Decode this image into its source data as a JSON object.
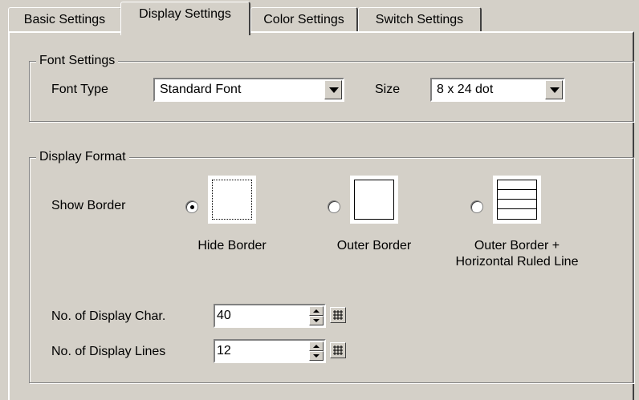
{
  "tabs": [
    {
      "label": "Basic Settings"
    },
    {
      "label": "Display Settings"
    },
    {
      "label": "Color Settings"
    },
    {
      "label": "Switch Settings"
    }
  ],
  "active_tab": "Display Settings",
  "font_settings": {
    "title": "Font Settings",
    "font_type_label": "Font Type",
    "font_type_value": "Standard Font",
    "size_label": "Size",
    "size_value": "8 x 24 dot"
  },
  "display_format": {
    "title": "Display Format",
    "show_border_label": "Show Border",
    "options": [
      {
        "label": "Hide Border",
        "selected": true
      },
      {
        "label": "Outer Border",
        "selected": false
      },
      {
        "label_line1": "Outer Border +",
        "label_line2": "Horizontal Ruled Line",
        "selected": false
      }
    ],
    "display_char_label": "No. of Display Char.",
    "display_char_value": "40",
    "display_lines_label": "No. of Display Lines",
    "display_lines_value": "12"
  }
}
